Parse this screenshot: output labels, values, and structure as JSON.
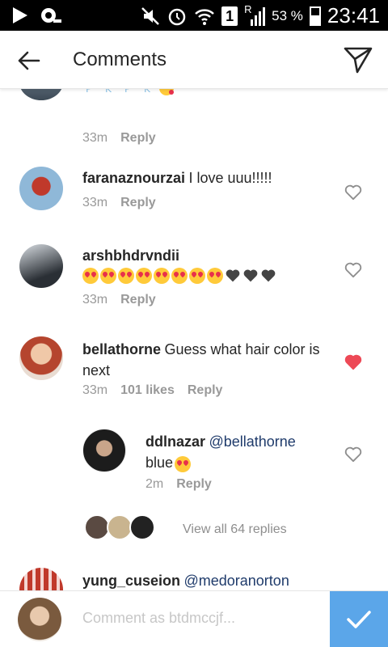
{
  "status_bar": {
    "battery": "53 %",
    "time": "23:41",
    "sim_slot": "1",
    "roaming": "R"
  },
  "header": {
    "title": "Comments"
  },
  "comments": [
    {
      "username": "",
      "text": "",
      "time": "33m",
      "reply_label": "Reply",
      "liked": false
    },
    {
      "username": "faranaznourzai",
      "text": "I love uuu!!!!!",
      "time": "33m",
      "reply_label": "Reply",
      "liked": false
    },
    {
      "username": "arshbhdrvndii",
      "text": "",
      "time": "33m",
      "reply_label": "Reply",
      "liked": false
    },
    {
      "username": "bellathorne",
      "text": "Guess what hair color is next",
      "time": "33m",
      "likes": "101 likes",
      "reply_label": "Reply",
      "liked": true
    }
  ],
  "reply": {
    "username": "ddlnazar",
    "mention": "@bellathorne",
    "text": "blue",
    "time": "2m",
    "reply_label": "Reply"
  },
  "view_replies": "View all 64 replies",
  "last_comment": {
    "username": "yung_cuseion",
    "mention": "@medoranorton"
  },
  "composer": {
    "placeholder": "Comment as btdmccjf..."
  },
  "colors": {
    "accent": "#3f97e6",
    "like_red": "#ed4956",
    "muted": "#999999"
  }
}
